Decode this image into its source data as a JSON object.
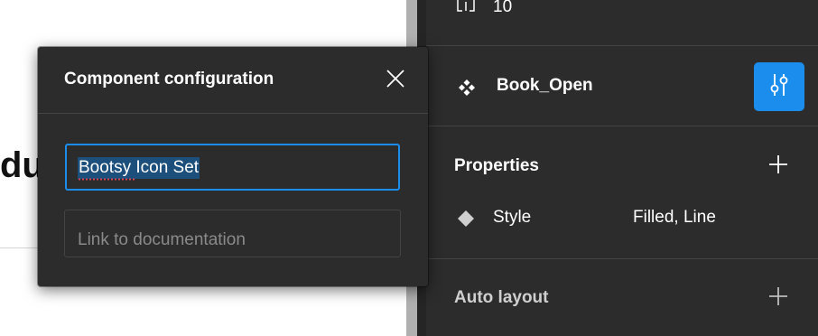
{
  "canvas": {
    "heading_fragment": "du"
  },
  "panel": {
    "gap_value": "10",
    "component": {
      "name": "Book_Open"
    },
    "properties": {
      "title": "Properties",
      "items": [
        {
          "name": "Style",
          "value": "Filled, Line"
        }
      ]
    },
    "auto_layout": {
      "title": "Auto layout"
    }
  },
  "modal": {
    "title": "Component configuration",
    "name_value": "Bootsy Icon Set",
    "doc_placeholder": "Link to documentation"
  },
  "colors": {
    "accent": "#1b8ded",
    "panel_bg": "#2c2c2c",
    "divider": "#444444",
    "spellcheck": "#e0445a"
  },
  "icons": {
    "gap": "spacing-gap-icon",
    "component": "component-icon",
    "config": "sliders-config-icon",
    "property": "variant-property-icon",
    "add": "plus-icon",
    "close": "close-icon"
  }
}
